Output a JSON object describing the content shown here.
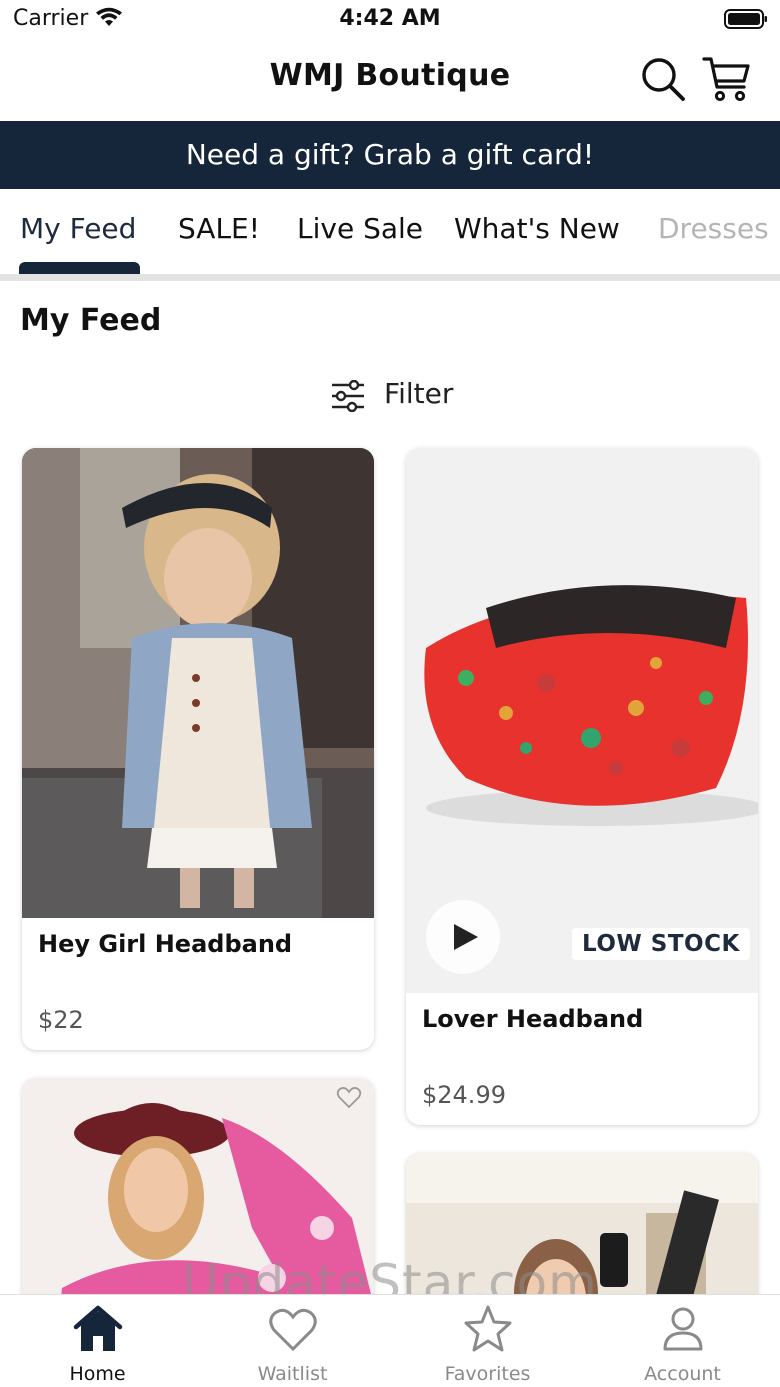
{
  "status_bar": {
    "carrier": "Carrier",
    "time": "4:42 AM"
  },
  "header": {
    "title": "WMJ Boutique",
    "search_icon": "search-icon",
    "cart_icon": "cart-icon"
  },
  "promo_banner": {
    "text": "Need a gift? Grab a gift card!",
    "background": "#15253a"
  },
  "tabs": [
    {
      "label": "My Feed",
      "active": true
    },
    {
      "label": "SALE!"
    },
    {
      "label": "Live Sale"
    },
    {
      "label": "What's New"
    },
    {
      "label": "Dresses"
    }
  ],
  "feed": {
    "title": "My Feed",
    "filter_label": "Filter",
    "products": [
      {
        "title": "Hey Girl Headband",
        "price": "$22"
      },
      {
        "title": "Lover Headband",
        "price": "$24.99",
        "badge": "LOW STOCK"
      },
      {
        "title": "",
        "price": ""
      },
      {
        "title": "",
        "price": ""
      }
    ]
  },
  "watermark": "UpdateStar.com",
  "bottom_nav": [
    {
      "label": "Home",
      "icon": "home-icon",
      "active": true
    },
    {
      "label": "Waitlist",
      "icon": "heart-icon"
    },
    {
      "label": "Favorites",
      "icon": "star-icon"
    },
    {
      "label": "Account",
      "icon": "account-icon"
    }
  ],
  "colors": {
    "accent": "#15253a",
    "muted": "#8a8a8a",
    "sale_red": "#e8322e"
  }
}
